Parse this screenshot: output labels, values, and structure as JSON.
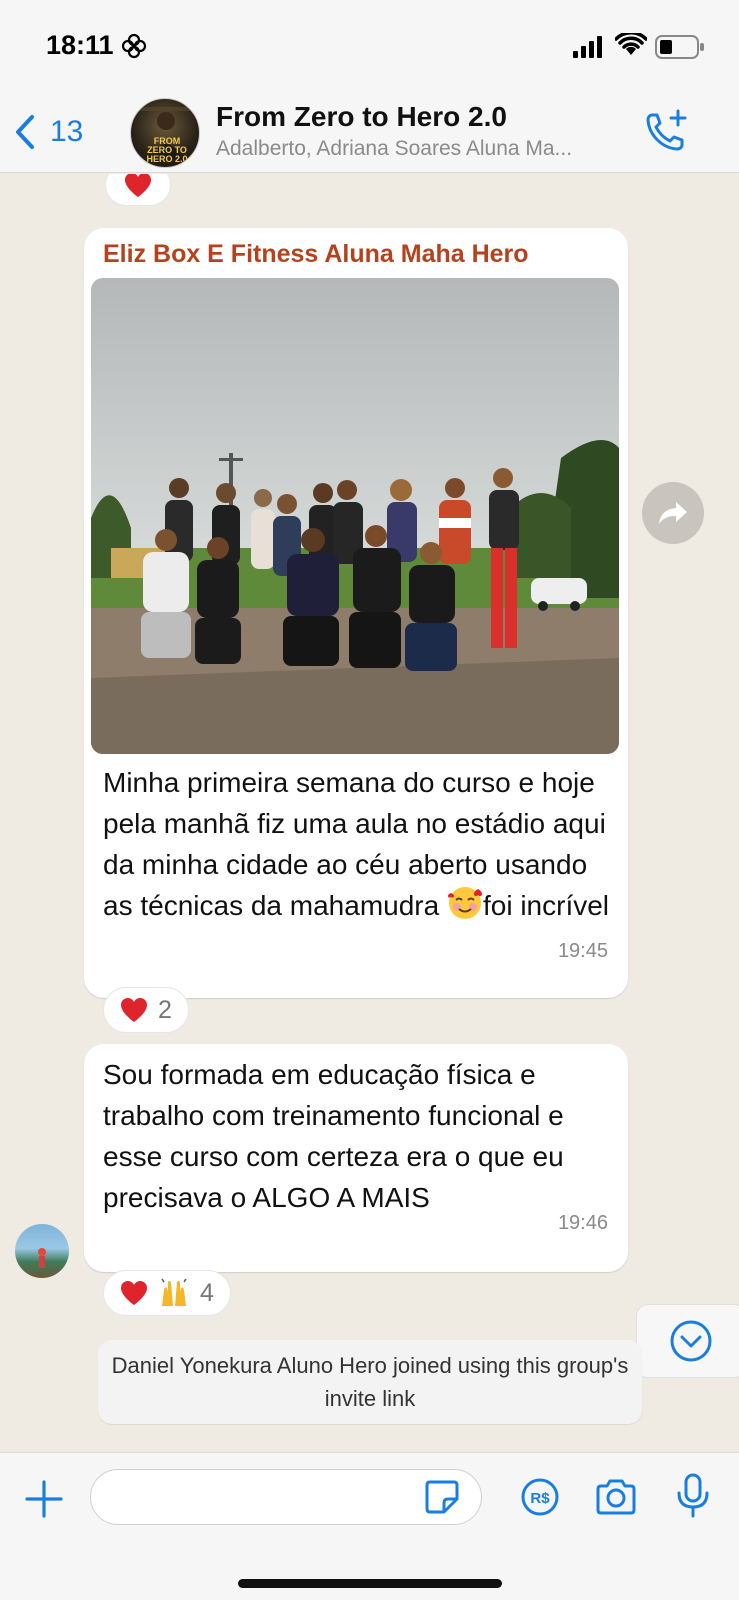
{
  "status_bar": {
    "time": "18:11"
  },
  "header": {
    "back_count": "13",
    "title": "From Zero to Hero 2.0",
    "subtitle": "Adalberto, Adriana Soares Aluna Ma...",
    "avatar_text": "FROM ZERO TO HERO 2.0"
  },
  "messages": [
    {
      "sender": "Eliz Box E Fitness Aluna Maha Hero",
      "text_before_emoji": "Minha primeira semana do curso e hoje pela manhã fiz uma aula no estádio aqui da minha cidade ao céu aberto usando as técnicas da mahamudra ",
      "text_after_emoji": "foi incrível",
      "time": "19:45",
      "reaction_count": "2"
    },
    {
      "text": "Sou formada em educação física e trabalho com treinamento funcional e esse curso com certeza era o que eu precisava o ALGO A MAIS",
      "time": "19:46",
      "reaction_count": "4"
    }
  ],
  "system_message": "Daniel Yonekura Aluno Hero joined using this group's invite link",
  "input": {
    "placeholder": ""
  },
  "colors": {
    "accent": "#1a7ee0",
    "sender_name": "#b5421c",
    "chat_bg": "#efeae2",
    "heart": "#e0242c"
  }
}
